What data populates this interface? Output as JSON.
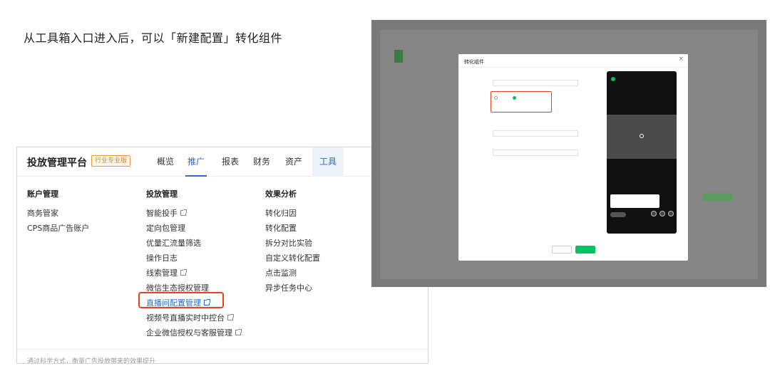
{
  "caption": "从工具箱入口进入后，可以「新建配置」转化组件",
  "platform": {
    "brand": "投放管理平台",
    "badge": "行业专业版",
    "nav": [
      "概览",
      "推广",
      "报表",
      "财务",
      "资产",
      "工具"
    ],
    "active_nav": "推广",
    "tool_nav": "工具"
  },
  "menu": {
    "account": {
      "heading": "账户管理",
      "items": [
        "商务管家",
        "CPS商品广告账户"
      ]
    },
    "ads": {
      "heading": "投放管理",
      "items": [
        "智能投手",
        "定向包管理",
        "优量汇流量筛选",
        "操作日志",
        "线索管理",
        "微信生态授权管理",
        "直播间配置管理",
        "视频号直播实时中控台",
        "企业微信授权与客服管理"
      ],
      "external": [
        "智能投手",
        "线索管理",
        "直播间配置管理",
        "视频号直播实时中控台",
        "企业微信授权与客服管理"
      ],
      "highlighted": "直播间配置管理"
    },
    "analysis": {
      "heading": "效果分析",
      "items": [
        "转化归因",
        "转化配置",
        "拆分对比实验",
        "自定义转化配置",
        "点击监测",
        "异步任务中心"
      ]
    },
    "footer": "通过科学方式，衡量广告投放带来的效果提升"
  },
  "colors": {
    "accent": "#1f6fd1",
    "highlight_border": "#e5431f",
    "badge": "#d9822b",
    "wechat_green": "#07c160",
    "overlay": "#7a7a7a"
  },
  "screenshot_modal": {
    "title": "转化组件",
    "close": "×"
  }
}
